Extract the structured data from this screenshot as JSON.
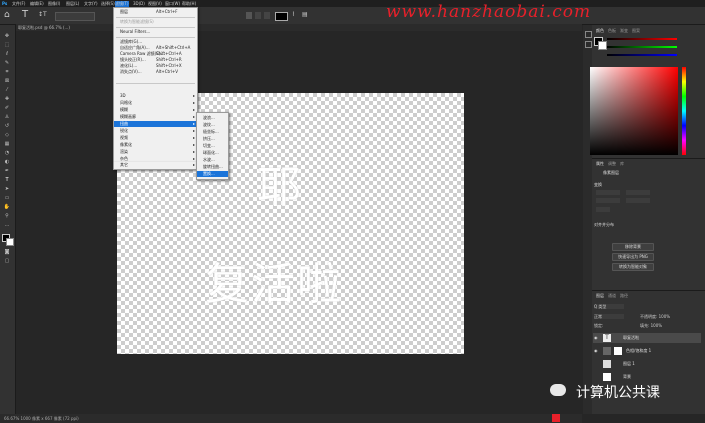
{
  "watermark": "www.hanzhaobai.com",
  "wechat_label": "计算机公共课",
  "canvas_text": {
    "line1": "耶",
    "line2": "复活啦"
  },
  "menubar": {
    "items": [
      "文件(F)",
      "编辑(E)",
      "图像(I)",
      "图层(L)",
      "文字(Y)",
      "选择(S)",
      "滤镜(T)",
      "3D(D)",
      "视图(V)",
      "窗口(W)",
      "帮助(H)"
    ]
  },
  "menubar_icon": "ps-logo-icon",
  "filter_menu": {
    "items": [
      {
        "label": "图层",
        "shortcut": "Alt+Ctrl+F"
      },
      {
        "label": "转换为智能滤镜(S)",
        "shortcut": "",
        "disabled": true
      },
      {
        "label": "Neural Filters...",
        "shortcut": ""
      },
      {
        "label": "滤镜库(G)...",
        "shortcut": ""
      },
      {
        "label": "自适应广角(A)...",
        "shortcut": "Alt+Shift+Ctrl+A"
      },
      {
        "label": "Camera Raw 滤镜(C)...",
        "shortcut": "Shift+Ctrl+A"
      },
      {
        "label": "镜头校正(R)...",
        "shortcut": "Shift+Ctrl+R"
      },
      {
        "label": "液化(L)...",
        "shortcut": "Shift+Ctrl+X"
      },
      {
        "label": "消失点(V)...",
        "shortcut": "Alt+Ctrl+V"
      },
      {
        "label": "3D",
        "submenu": true
      },
      {
        "label": "风格化",
        "submenu": true
      },
      {
        "label": "模糊",
        "submenu": true
      },
      {
        "label": "模糊画廊",
        "submenu": true
      },
      {
        "label": "扭曲",
        "submenu": true,
        "highlighted": true
      },
      {
        "label": "锐化",
        "submenu": true
      },
      {
        "label": "视频",
        "submenu": true
      },
      {
        "label": "像素化",
        "submenu": true
      },
      {
        "label": "渲染",
        "submenu": true
      },
      {
        "label": "杂色",
        "submenu": true
      },
      {
        "label": "其它",
        "submenu": true
      }
    ]
  },
  "distort_submenu": {
    "items": [
      {
        "label": "波浪..."
      },
      {
        "label": "波纹..."
      },
      {
        "label": "极坐标..."
      },
      {
        "label": "挤压..."
      },
      {
        "label": "切变..."
      },
      {
        "label": "球面化..."
      },
      {
        "label": "水波..."
      },
      {
        "label": "旋转扭曲..."
      },
      {
        "label": "置换...",
        "highlighted": true
      }
    ]
  },
  "document_tab": "耶复活啦.psd @ 66.7% (...)",
  "status_text": "66.67%   1000 像素 x 667 像素 (72 ppi)",
  "panels": {
    "color_tabs": [
      "颜色",
      "色板",
      "渐变",
      "图案"
    ],
    "props_tabs": [
      "属性",
      "调整",
      "库"
    ],
    "props_title": "像素图层",
    "transform_label": "变换",
    "align_label": "对齐并分布",
    "props_buttons": [
      "移除背景",
      "快速导出为 PNG",
      "转换为智能对象"
    ],
    "layers_tabs": [
      "图层",
      "通道",
      "路径"
    ],
    "layers_search": "Q 类型",
    "blend_mode": "正常",
    "opacity_label": "不透明度: 100%",
    "fill_label": "填充: 100%",
    "lock_label": "锁定:",
    "layers": [
      {
        "name": "耶复活啦",
        "selected": true
      },
      {
        "name": "色相/饱和度 1",
        "selected": false
      },
      {
        "name": "图层 1",
        "selected": false
      },
      {
        "name": "背景",
        "selected": false
      }
    ]
  },
  "colors": {
    "accent": "#1b74d9",
    "panel_bg": "#323232",
    "menu_bg": "#f0f0f0",
    "watermark": "#e8202a"
  }
}
